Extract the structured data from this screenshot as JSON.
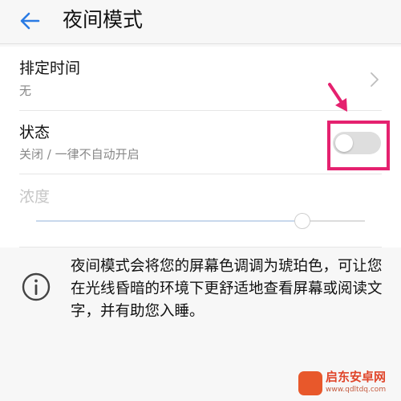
{
  "header": {
    "title": "夜间模式"
  },
  "settings": {
    "schedule": {
      "label": "排定时间",
      "value": "无"
    },
    "status": {
      "label": "状态",
      "value": "关闭 / 一律不自动开启",
      "enabled": false
    },
    "density": {
      "label": "浓度",
      "level_percent": 81
    }
  },
  "info": {
    "text": "夜间模式会将您的屏幕色调调为琥珀色，可让您在光线昏暗的环境下更舒适地查看屏幕或阅读文字，并有助您入睡。"
  },
  "watermark": {
    "name": "启东安卓网",
    "url": "www.qdltdq.com"
  },
  "colors": {
    "accent": "#2a7be4",
    "highlight": "#e5216f"
  },
  "icons": [
    "back-arrow-icon",
    "chevron-right-icon",
    "info-icon",
    "annotation-arrow-icon"
  ]
}
